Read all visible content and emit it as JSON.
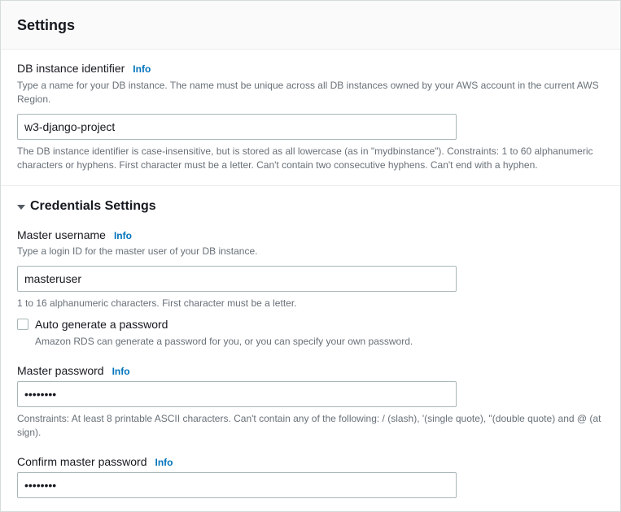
{
  "header": {
    "title": "Settings"
  },
  "dbIdentifier": {
    "label": "DB instance identifier",
    "infoLabel": "Info",
    "description": "Type a name for your DB instance. The name must be unique across all DB instances owned by your AWS account in the current AWS Region.",
    "value": "w3-django-project",
    "constraint": "The DB instance identifier is case-insensitive, but is stored as all lowercase (as in \"mydbinstance\"). Constraints: 1 to 60 alphanumeric characters or hyphens. First character must be a letter. Can't contain two consecutive hyphens. Can't end with a hyphen."
  },
  "credentials": {
    "sectionTitle": "Credentials Settings",
    "masterUsername": {
      "label": "Master username",
      "infoLabel": "Info",
      "description": "Type a login ID for the master user of your DB instance.",
      "value": "masteruser",
      "constraint": "1 to 16 alphanumeric characters. First character must be a letter."
    },
    "autoGenerate": {
      "label": "Auto generate a password",
      "description": "Amazon RDS can generate a password for you, or you can specify your own password.",
      "checked": false
    },
    "masterPassword": {
      "label": "Master password",
      "infoLabel": "Info",
      "value": "••••••••",
      "constraint": "Constraints: At least 8 printable ASCII characters. Can't contain any of the following: / (slash), '(single quote), \"(double quote) and @ (at sign)."
    },
    "confirmPassword": {
      "label": "Confirm master password",
      "infoLabel": "Info",
      "value": "••••••••"
    }
  }
}
